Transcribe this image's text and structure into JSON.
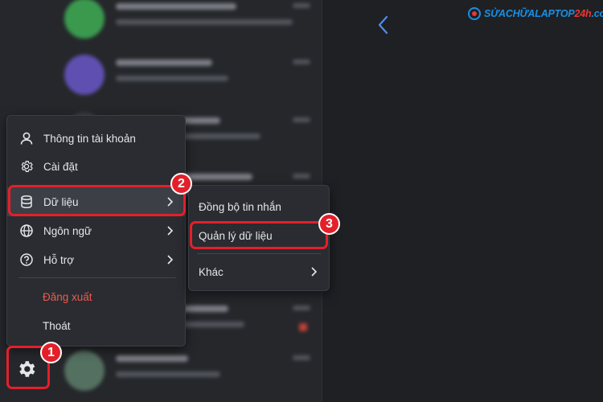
{
  "watermark": {
    "logo_text_main": "SỬACHỮALAPTOP",
    "logo_text_accent": "24h",
    "logo_text_suffix": ".com"
  },
  "menu": {
    "items": [
      {
        "label": "Thông tin tài khoản",
        "icon": "user-icon"
      },
      {
        "label": "Cài đặt",
        "icon": "settings-icon"
      },
      {
        "label": "Dữ liệu",
        "icon": "database-icon",
        "has_submenu": true
      },
      {
        "label": "Ngôn ngữ",
        "icon": "globe-icon",
        "has_submenu": true
      },
      {
        "label": "Hỗ trợ",
        "icon": "help-icon",
        "has_submenu": true
      }
    ],
    "logout_label": "Đăng xuất",
    "quit_label": "Thoát"
  },
  "submenu": {
    "items": [
      {
        "label": "Đồng bộ tin nhắn"
      },
      {
        "label": "Quản lý dữ liệu"
      },
      {
        "label": "Khác",
        "has_submenu": true
      }
    ]
  },
  "badges": {
    "step1": "1",
    "step2": "2",
    "step3": "3"
  },
  "colors": {
    "highlight": "#e3202a",
    "logout": "#ef5a4c",
    "brand_blue": "#1a8fe3"
  }
}
